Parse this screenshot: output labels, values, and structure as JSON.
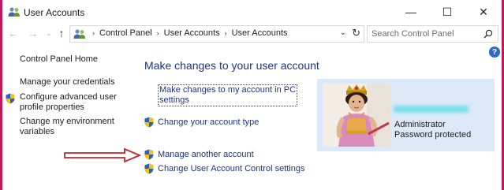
{
  "window": {
    "title": "User Accounts",
    "icon": "user-accounts-icon",
    "controls": {
      "minimize": "—",
      "maximize": "☐",
      "close": "✕"
    }
  },
  "navigation": {
    "back": "←",
    "forward": "→",
    "recent": "⌄",
    "up": "↑",
    "breadcrumbs": [
      "Control Panel",
      "User Accounts",
      "User Accounts"
    ],
    "separator": "›",
    "dropdown": "⌄",
    "refresh": "↻",
    "search": {
      "placeholder": "Search Control Panel",
      "value": ""
    }
  },
  "help": {
    "label": "?"
  },
  "sidebar": {
    "items": [
      {
        "label": "Control Panel Home",
        "shield": false
      },
      {
        "label": "Manage your credentials",
        "shield": false
      },
      {
        "label": "Configure advanced user\nprofile properties",
        "line1": "Configure advanced user",
        "line2": "profile properties",
        "shield": true
      },
      {
        "label": "Change my environment\nvariables",
        "line1": "Change my environment",
        "line2": "variables",
        "shield": false
      }
    ]
  },
  "main": {
    "title": "Make changes to your user account",
    "tasks": [
      {
        "line1": "Make changes to my account in PC",
        "line2": "settings",
        "shield": false
      },
      {
        "label": "Change your account type",
        "shield": true
      },
      {
        "label": "Manage another account",
        "shield": true
      },
      {
        "label": "Change User Account Control settings",
        "shield": true
      }
    ]
  },
  "user": {
    "role": "Administrator",
    "status": "Password protected"
  },
  "colors": {
    "accent_link": "#1e3287",
    "card_bg": "#dbe9f8",
    "frame": "#c2185b",
    "annotation_arrow": "#c0282b"
  }
}
